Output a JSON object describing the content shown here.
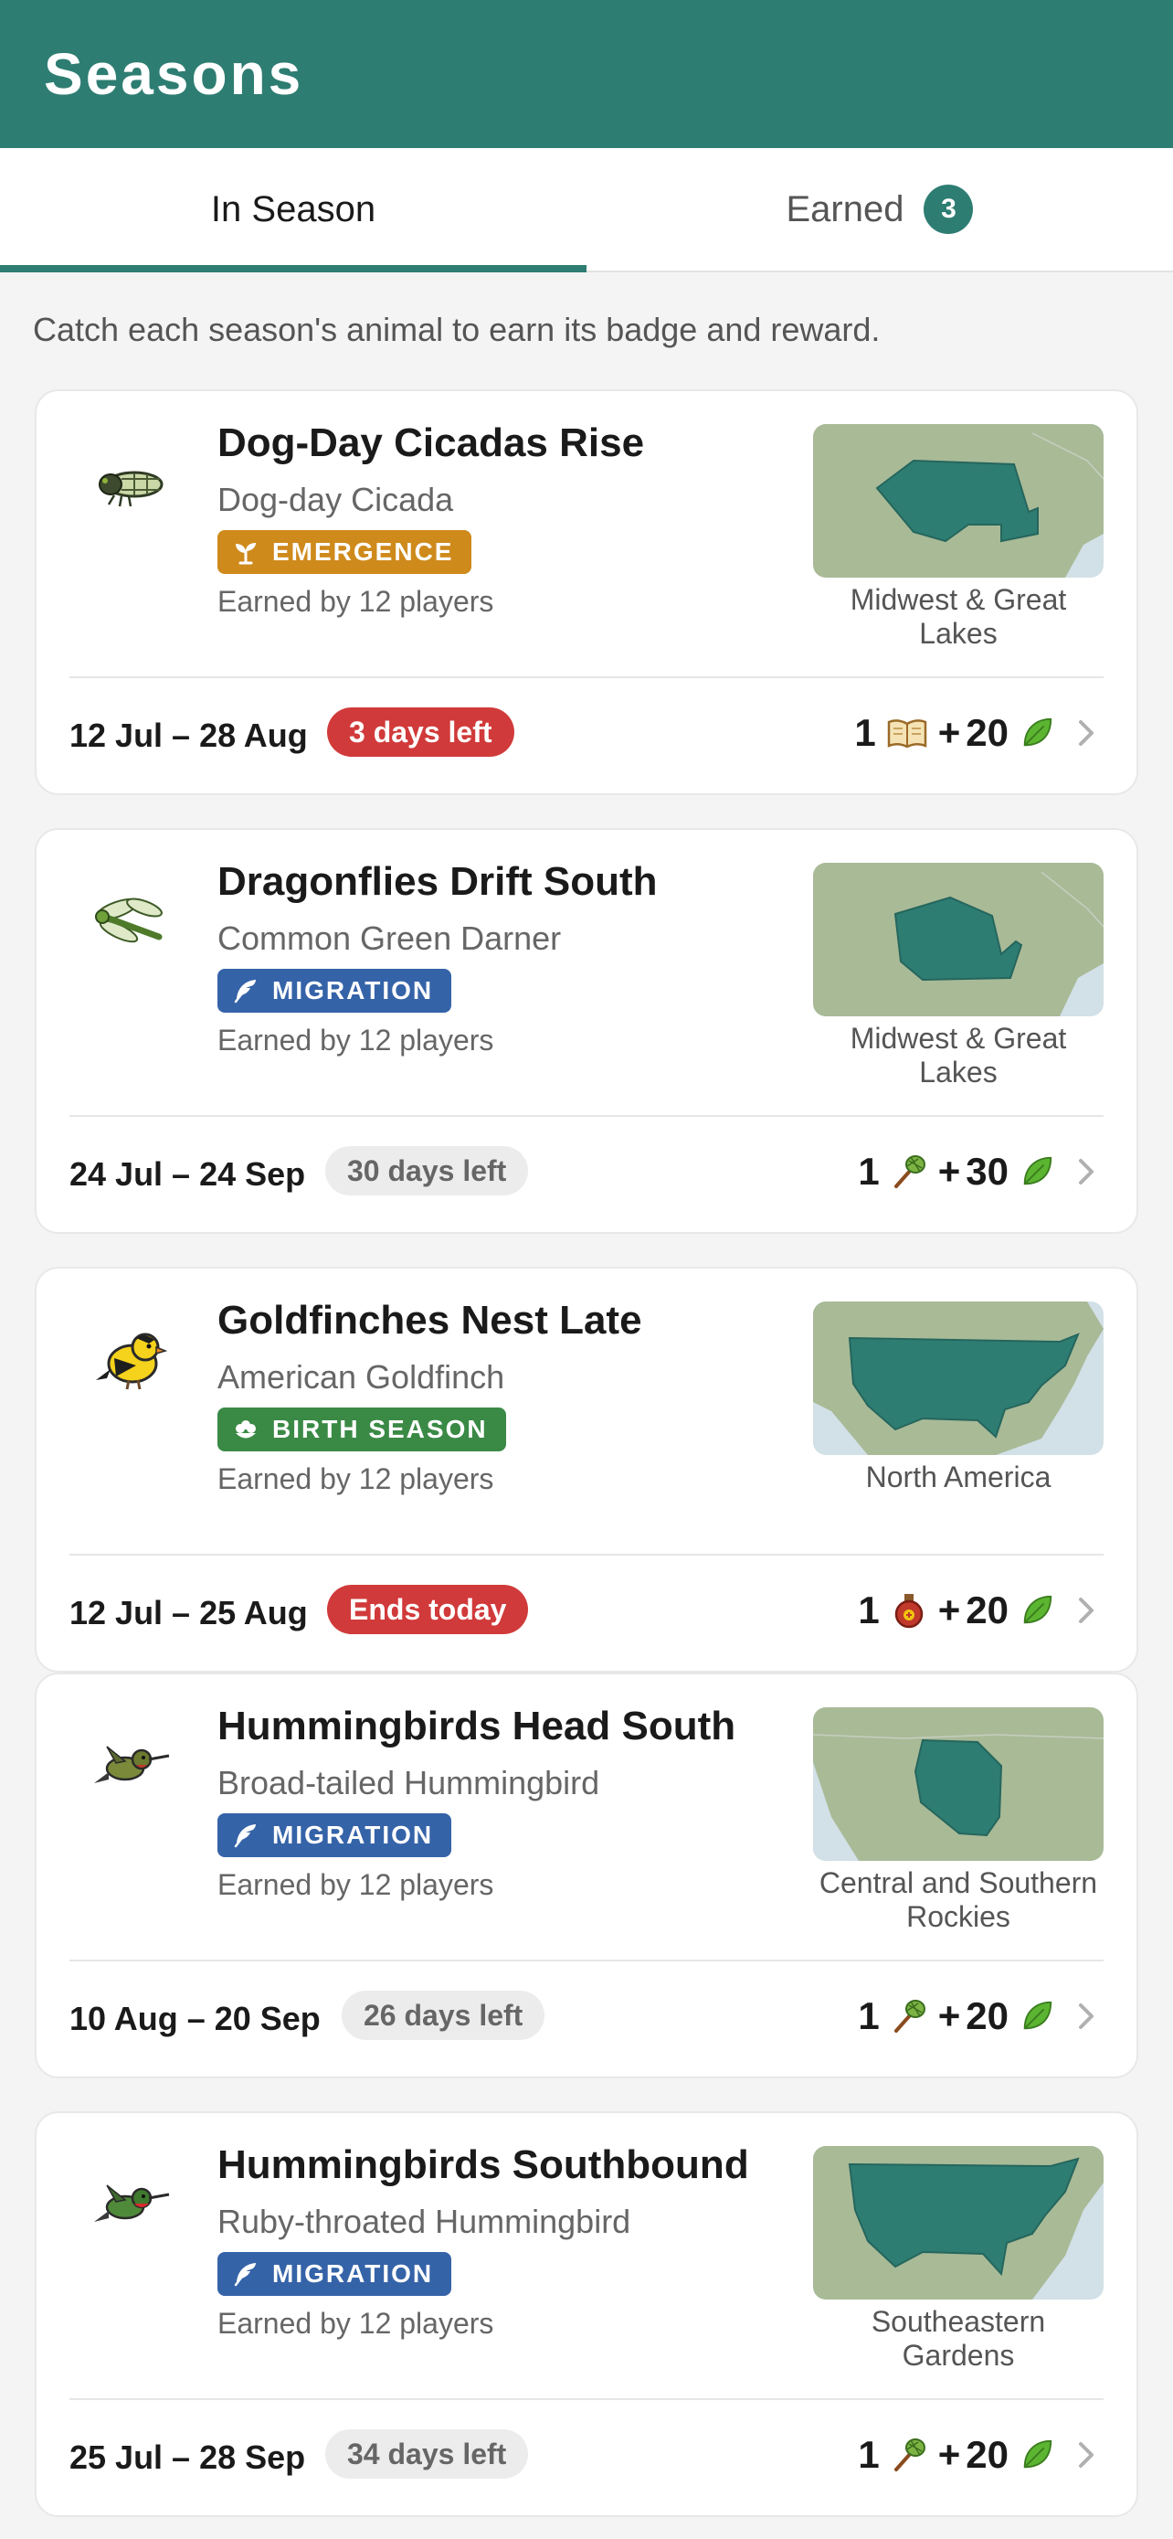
{
  "header": {
    "title": "Seasons"
  },
  "tabs": {
    "in_season": "In Season",
    "earned": "Earned",
    "earned_count": "3"
  },
  "intro": "Catch each season's animal to earn its badge and reward.",
  "colors": {
    "brand": "#2e7d72",
    "emergence": "#cf8a1c",
    "migration": "#3563a8",
    "birth_season": "#3a8a45",
    "urgent": "#d13a3a"
  },
  "cards": [
    {
      "title": "Dog-Day Cicadas Rise",
      "species": "Dog-day Cicada",
      "tag": "EMERGENCE",
      "tag_icon": "sprout-icon",
      "earned": "Earned by 12 players",
      "region": "Midwest & Great Lakes",
      "dates": "12 Jul – 28 Aug",
      "status": "3 days left",
      "status_style": "urgent",
      "reward_qty": "1",
      "reward_item_icon": "book-icon",
      "reward_plus": "+",
      "reward_leaves": "20",
      "animal_icon": "cicada-icon"
    },
    {
      "title": "Dragonflies Drift South",
      "species": "Common Green Darner",
      "tag": "MIGRATION",
      "tag_icon": "feather-icon",
      "earned": "Earned by 12 players",
      "region": "Midwest & Great Lakes",
      "dates": "24 Jul – 24 Sep",
      "status": "30 days left",
      "status_style": "normal",
      "reward_qty": "1",
      "reward_item_icon": "net-icon",
      "reward_plus": "+",
      "reward_leaves": "30",
      "animal_icon": "dragonfly-icon"
    },
    {
      "title": "Goldfinches Nest Late",
      "species": "American Goldfinch",
      "tag": "BIRTH SEASON",
      "tag_icon": "flower-icon",
      "earned": "Earned by 12 players",
      "region": "North America",
      "dates": "12 Jul – 25 Aug",
      "status": "Ends today",
      "status_style": "urgent",
      "reward_qty": "1",
      "reward_item_icon": "potion-icon",
      "reward_plus": "+",
      "reward_leaves": "20",
      "animal_icon": "goldfinch-icon"
    },
    {
      "title": "Hummingbirds Head South",
      "species": "Broad-tailed Hummingbird",
      "tag": "MIGRATION",
      "tag_icon": "feather-icon",
      "earned": "Earned by 12 players",
      "region": "Central and Southern Rockies",
      "dates": "10 Aug – 20 Sep",
      "status": "26 days left",
      "status_style": "normal",
      "reward_qty": "1",
      "reward_item_icon": "net-icon",
      "reward_plus": "+",
      "reward_leaves": "20",
      "animal_icon": "hummingbird-icon"
    },
    {
      "title": "Hummingbirds Southbound",
      "species": "Ruby-throated Hummingbird",
      "tag": "MIGRATION",
      "tag_icon": "feather-icon",
      "earned": "Earned by 12 players",
      "region": "Southeastern Gardens",
      "dates": "25 Jul – 28 Sep",
      "status": "34 days left",
      "status_style": "normal",
      "reward_qty": "1",
      "reward_item_icon": "net-icon",
      "reward_plus": "+",
      "reward_leaves": "20",
      "animal_icon": "hummingbird-icon"
    }
  ]
}
